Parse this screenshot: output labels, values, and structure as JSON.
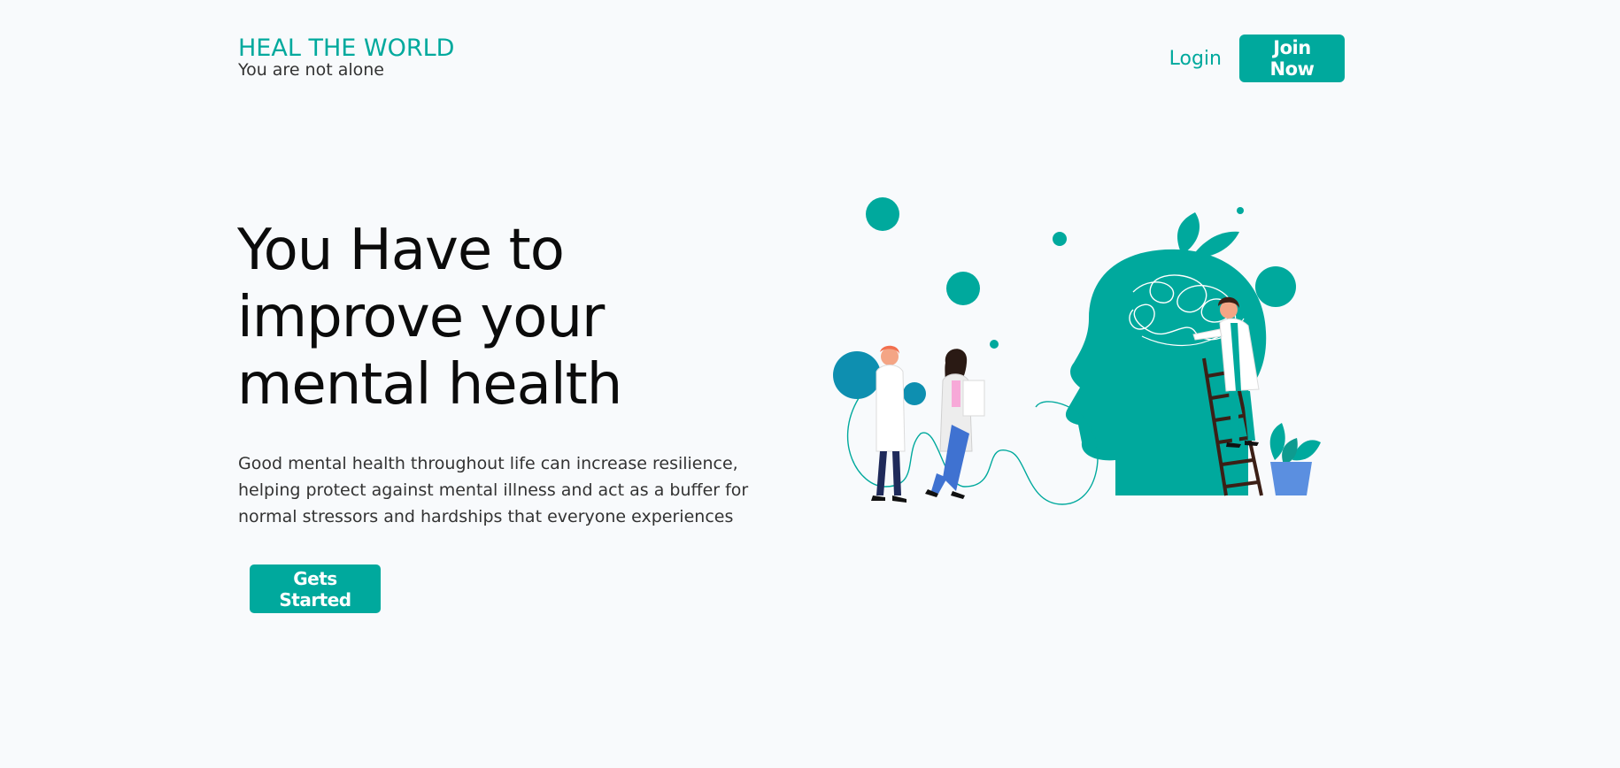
{
  "header": {
    "brand_title": "HEAL THE WORLD",
    "brand_subtitle": "You are not alone",
    "login_label": "Login",
    "join_label": "Join Now"
  },
  "hero": {
    "title": "You Have to improve your mental health",
    "description": "Good mental health throughout life can increase resilience, helping protect against mental illness and act as a buffer for normal stressors and hardships that everyone experiences",
    "cta_label": "Gets Started",
    "illustration": "mental-health-head-illustration"
  },
  "colors": {
    "accent": "#00a99d",
    "background": "#f8fafc",
    "text": "#0b0b0b",
    "secondary_accent": "#0e8fb0",
    "pot_blue": "#5b8fe0"
  }
}
